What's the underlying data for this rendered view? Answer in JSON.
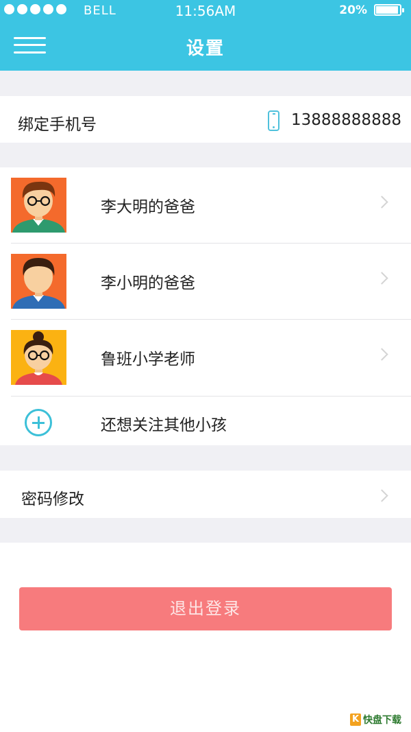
{
  "status_bar": {
    "signal_dots": 5,
    "carrier": "BELL",
    "time": "11:56AM",
    "battery_percent": "20%",
    "battery_level": 0.95
  },
  "header": {
    "title": "设置",
    "menu_icon": "hamburger-menu-icon"
  },
  "phone_binding": {
    "label": "绑定手机号",
    "icon": "mobile-phone-icon",
    "number": "13888888888"
  },
  "accounts": [
    {
      "label": "李大明的爸爸",
      "avatar": "boy-with-glasses-avatar",
      "avatar_bg": "#f46a2c"
    },
    {
      "label": "李小明的爸爸",
      "avatar": "boy-avatar",
      "avatar_bg": "#f46a2c"
    },
    {
      "label": "鲁班小学老师",
      "avatar": "girl-with-glasses-avatar",
      "avatar_bg": "#fbb212"
    }
  ],
  "add_child": {
    "label": "还想关注其他小孩",
    "icon": "plus-circle-icon"
  },
  "password": {
    "label": "密码修改"
  },
  "logout": {
    "label": "退出登录"
  },
  "watermark": {
    "text": "快盘下载"
  },
  "colors": {
    "header_bg": "#3cc5e3",
    "accent": "#3cc0d8",
    "logout_bg": "#f77b7d",
    "page_bg": "#f0f0f4"
  }
}
